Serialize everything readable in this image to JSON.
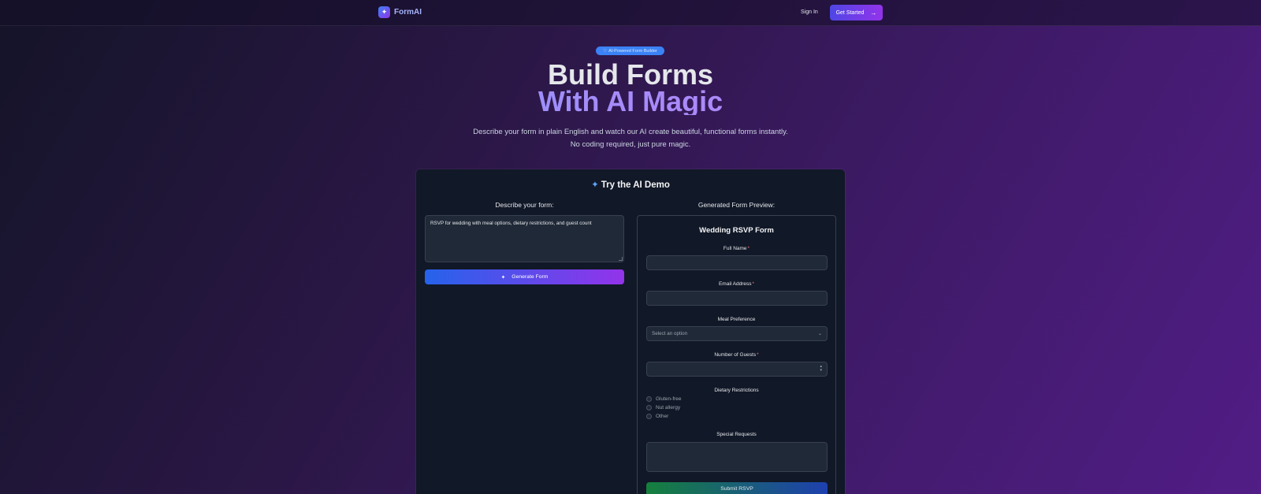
{
  "nav": {
    "brand": "FormAI",
    "sign_in": "Sign In",
    "get_started": "Get Started"
  },
  "hero": {
    "badge": "AI-Powered Form Builder",
    "title_line1": "Build Forms",
    "title_line2": "With AI Magic",
    "subtitle": "Describe your form in plain English and watch our AI create beautiful, functional forms instantly. No coding required, just pure magic."
  },
  "demo": {
    "title": "Try the AI Demo",
    "describe_label": "Describe your form:",
    "prompt_text": "RSVP for wedding with meal options, dietary restrictions, and guest count",
    "generate_button": "Generate Form",
    "preview_label": "Generated Form Preview:"
  },
  "form": {
    "title": "Wedding RSVP Form",
    "full_name_label": "Full Name",
    "email_label": "Email Address",
    "meal_label": "Meal Preference",
    "meal_placeholder": "Select an option",
    "guests_label": "Number of Guests",
    "dietary_label": "Dietary Restrictions",
    "dietary_options": [
      "Gluten-free",
      "Nut allergy",
      "Other"
    ],
    "special_label": "Special Requests",
    "submit_button": "Submit RSVP",
    "required_mark": "*"
  },
  "colors": {
    "accent_blue": "#3b82f6",
    "accent_purple": "#9333ea",
    "card_bg": "#111827",
    "required_red": "#f87171"
  }
}
